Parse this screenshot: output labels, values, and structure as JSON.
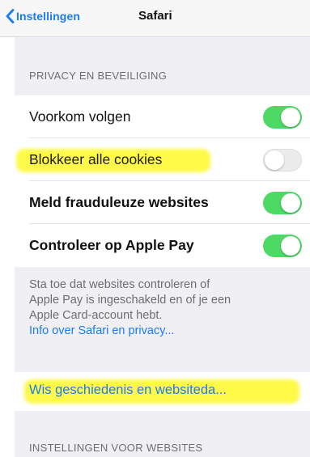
{
  "navbar": {
    "back_label": "Instellingen",
    "title": "Safari"
  },
  "privacy_section": {
    "header": "PRIVACY EN BEVEILIGING",
    "rows": [
      {
        "label": "Voorkom volgen",
        "toggle": "on"
      },
      {
        "label": "Blokkeer alle cookies",
        "toggle": "off"
      },
      {
        "label": "Meld frauduleuze websites",
        "toggle": "on"
      },
      {
        "label": "Controleer op Apple Pay",
        "toggle": "on"
      }
    ],
    "footer_lines": [
      "Sta toe dat websites controleren of",
      "Apple Pay is ingeschakeld en of je een",
      "Apple Card-account hebt."
    ],
    "footer_link": "Info over Safari en privacy..."
  },
  "clear_history": {
    "label": "Wis geschiedenis en websiteda..."
  },
  "website_settings_section": {
    "header": "INSTELLINGEN VOOR WEBSITES"
  },
  "colors": {
    "accent": "#1a7cf5",
    "toggle_on": "#4cd964",
    "highlight": "#fff828",
    "background": "#efeff4"
  }
}
